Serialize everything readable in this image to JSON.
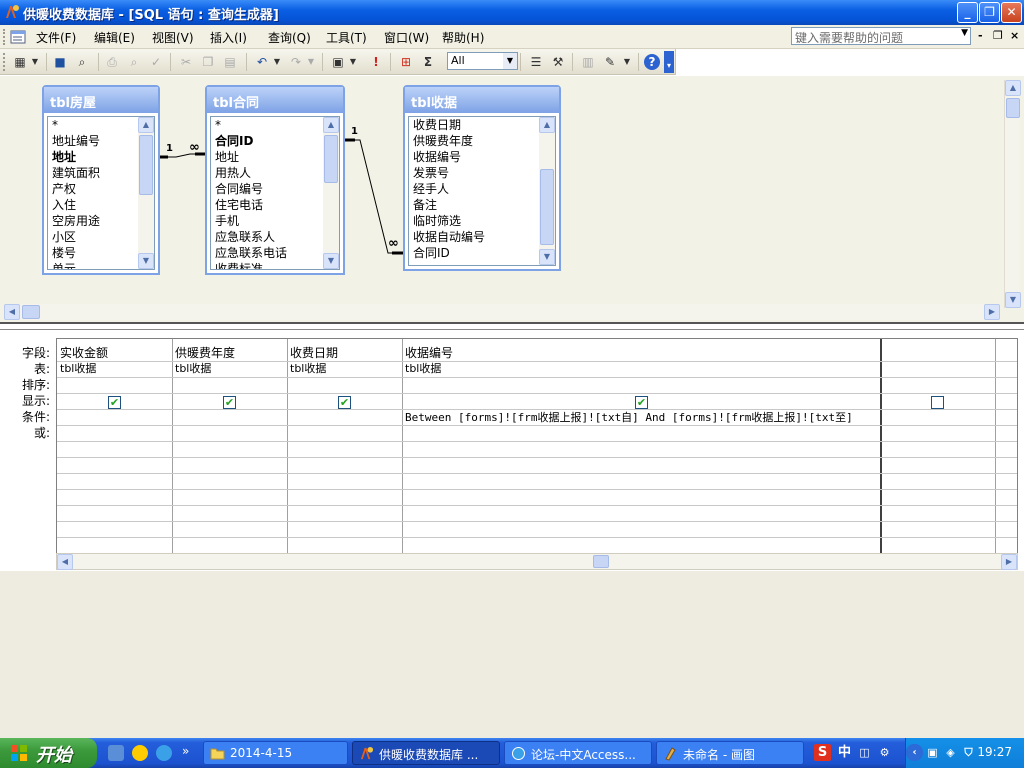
{
  "window": {
    "title": "供暖收费数据库 - [SQL 语句 : 查询生成器]",
    "controls": {
      "minimize": "_",
      "restore": "❐",
      "close": "✕"
    }
  },
  "menu": {
    "items": [
      "文件(F)",
      "编辑(E)",
      "视图(V)",
      "插入(I)",
      "查询(Q)",
      "工具(T)",
      "窗口(W)",
      "帮助(H)"
    ],
    "help_placeholder": "键入需要帮助的问题",
    "mdi": {
      "minimize": "-",
      "restore": "❐",
      "close": "×"
    }
  },
  "toolbar": {
    "top_values": "All",
    "sigma": "Σ",
    "run": "!"
  },
  "tables": [
    {
      "name": "tbl房屋",
      "fields": [
        {
          "label": "*",
          "bold": false
        },
        {
          "label": "地址编号",
          "bold": false
        },
        {
          "label": "地址",
          "bold": true
        },
        {
          "label": "建筑面积",
          "bold": false
        },
        {
          "label": "产权",
          "bold": false
        },
        {
          "label": "入住",
          "bold": false
        },
        {
          "label": "空房用途",
          "bold": false
        },
        {
          "label": "小区",
          "bold": false
        },
        {
          "label": "楼号",
          "bold": false
        },
        {
          "label": "单元",
          "bold": false
        }
      ]
    },
    {
      "name": "tbl合同",
      "fields": [
        {
          "label": "*",
          "bold": false
        },
        {
          "label": "合同ID",
          "bold": true
        },
        {
          "label": "地址",
          "bold": false
        },
        {
          "label": "用热人",
          "bold": false
        },
        {
          "label": "合同编号",
          "bold": false
        },
        {
          "label": "住宅电话",
          "bold": false
        },
        {
          "label": "手机",
          "bold": false
        },
        {
          "label": "应急联系人",
          "bold": false
        },
        {
          "label": "应急联系电话",
          "bold": false
        },
        {
          "label": "收费标准",
          "bold": false
        }
      ]
    },
    {
      "name": "tbl收据",
      "fields": [
        {
          "label": "收费日期",
          "bold": false
        },
        {
          "label": "供暖费年度",
          "bold": false
        },
        {
          "label": "收据编号",
          "bold": false
        },
        {
          "label": "发票号",
          "bold": false
        },
        {
          "label": "经手人",
          "bold": false
        },
        {
          "label": "备注",
          "bold": false
        },
        {
          "label": "临时筛选",
          "bold": false
        },
        {
          "label": "收据自动编号",
          "bold": false
        },
        {
          "label": "合同ID",
          "bold": false
        }
      ]
    }
  ],
  "relationships": [
    {
      "from": "tbl房屋",
      "to": "tbl合同",
      "one": "1",
      "many": "∞"
    },
    {
      "from": "tbl合同",
      "to": "tbl收据",
      "one": "1",
      "many": "∞"
    }
  ],
  "grid": {
    "row_labels": [
      "字段:",
      "表:",
      "排序:",
      "显示:",
      "条件:",
      "或:"
    ],
    "columns": [
      {
        "field": "实收金额",
        "table": "tbl收据",
        "sort": "",
        "show": true,
        "criteria": ""
      },
      {
        "field": "供暖费年度",
        "table": "tbl收据",
        "sort": "",
        "show": true,
        "criteria": ""
      },
      {
        "field": "收费日期",
        "table": "tbl收据",
        "sort": "",
        "show": true,
        "criteria": ""
      },
      {
        "field": "收据编号",
        "table": "tbl收据",
        "sort": "",
        "show": true,
        "criteria": "Between [forms]![frm收据上报]![txt自] And [forms]![frm收据上报]![txt至]"
      },
      {
        "field": "",
        "table": "",
        "sort": "",
        "show": false,
        "criteria": ""
      },
      {
        "field": "",
        "table": "",
        "sort": "",
        "show": null,
        "criteria": ""
      }
    ]
  },
  "taskbar": {
    "start_label": "开始",
    "overflow": "»",
    "tasks": [
      {
        "label": "2014-4-15",
        "icon": "folder-icon",
        "active": false
      },
      {
        "label": "供暖收费数据库 ...",
        "icon": "access-icon",
        "active": true
      },
      {
        "label": "论坛-中文Access...",
        "icon": "browser-icon",
        "active": false
      },
      {
        "label": "未命名 - 画图",
        "icon": "paint-icon",
        "active": false
      }
    ],
    "ime": [
      "S",
      "中"
    ],
    "clock": "19:27"
  },
  "colors": {
    "titlebar": "#0a5fe3",
    "table_header": "#7ea2e6",
    "upper_pane": "#f3f2e6",
    "taskbar": "#245edb",
    "start": "#3c9a3c"
  }
}
